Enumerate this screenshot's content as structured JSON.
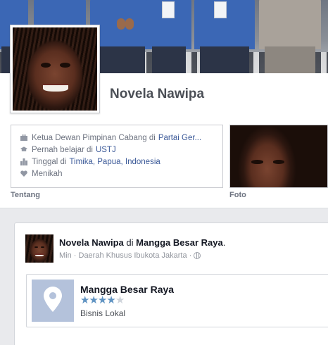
{
  "profile": {
    "name": "Novela Nawipa"
  },
  "about": {
    "items": [
      {
        "icon": "briefcase-icon",
        "prefix": "Ketua Dewan Pimpinan Cabang di",
        "link": "Partai Ger..."
      },
      {
        "icon": "graduation-cap-icon",
        "prefix": "Pernah belajar di",
        "link": "USTJ"
      },
      {
        "icon": "city-icon",
        "prefix": "Tinggal di",
        "link": "Timika, Papua, Indonesia"
      },
      {
        "icon": "heart-icon",
        "prefix": "Menikah",
        "link": ""
      }
    ],
    "section_label": "Tentang"
  },
  "photos": {
    "section_label": "Foto"
  },
  "post": {
    "author": "Novela Nawipa",
    "connector": "di",
    "place": "Mangga Besar Raya",
    "meta": "Min · Daerah Khusus Ibukota Jakarta ·",
    "privacy_icon": "globe-icon",
    "place_card": {
      "name": "Mangga Besar Raya",
      "rating": 4,
      "rating_max": 5,
      "category": "Bisnis Lokal",
      "icon": "map-pin-icon"
    }
  },
  "colors": {
    "link": "#3b5998",
    "star_on": "#5f93c2",
    "star_off": "#cfd4db"
  }
}
